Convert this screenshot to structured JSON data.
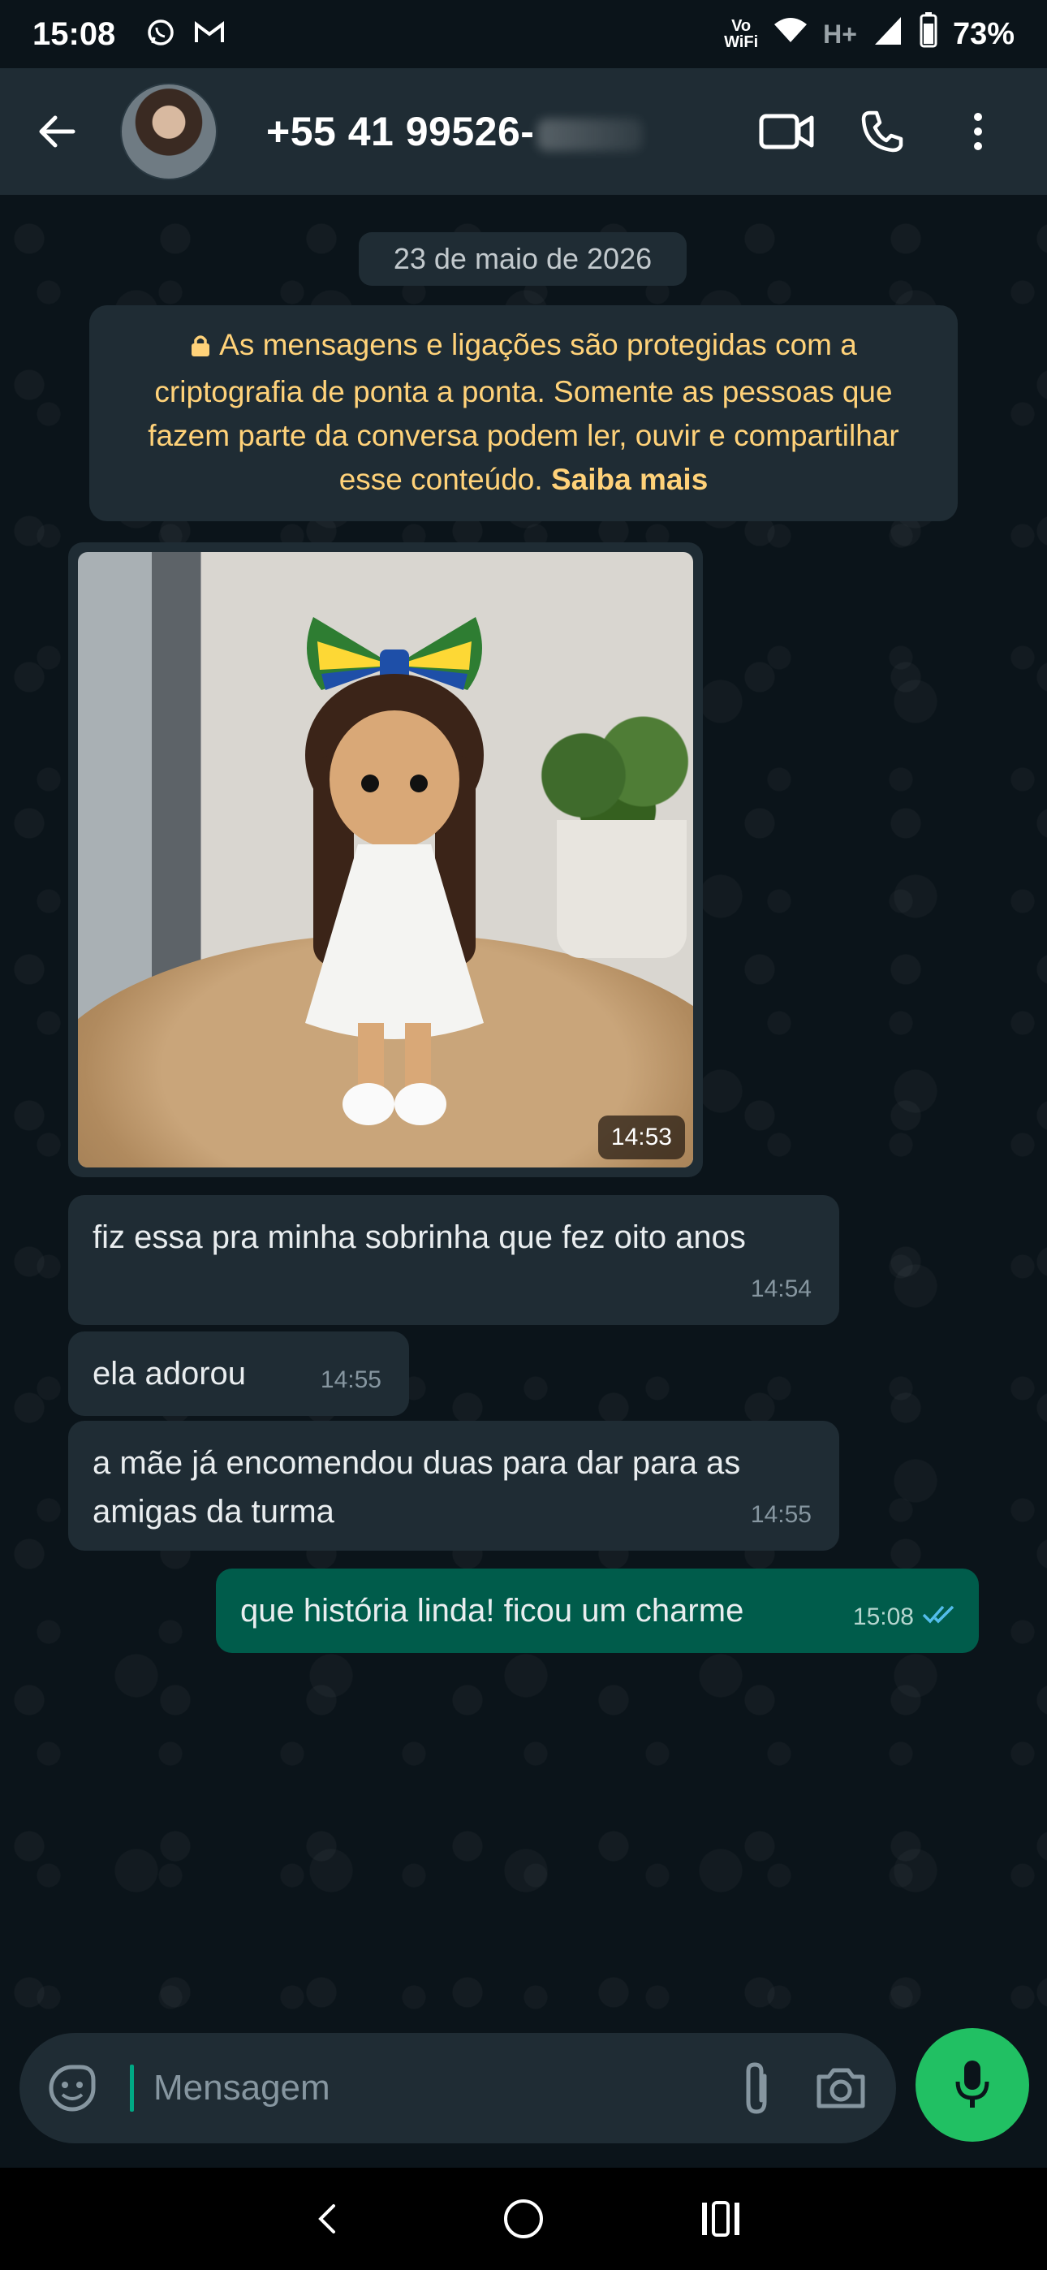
{
  "status_bar": {
    "time": "15:08",
    "left_icons": [
      "whatsapp-icon",
      "gmail-icon"
    ],
    "vowifi": "Vo\nWiFi",
    "network": "H+",
    "battery": "73%"
  },
  "header": {
    "contact_name": "+55 41 99526-",
    "icons": [
      "back-arrow-icon",
      "avatar",
      "video-call-icon",
      "phone-call-icon",
      "more-vert-icon"
    ]
  },
  "chat": {
    "date_chip": "23 de maio de 2026",
    "e2e_notice": {
      "text": "As mensagens e ligações são protegidas com a criptografia de ponta a ponta. Somente as pessoas que fazem parte da conversa podem ler, ouvir e compartilhar esse conteúdo.",
      "link": "Saiba mais",
      "color": "#ffd279"
    },
    "image_message": {
      "time": "14:53"
    },
    "messages": [
      {
        "direction": "in",
        "text": "fiz essa pra minha sobrinha que fez oito anos",
        "time": "14:54"
      },
      {
        "direction": "in",
        "text": "ela adorou",
        "time": "14:55"
      },
      {
        "direction": "in",
        "text": "a mãe já encomendou duas para dar para as amigas da turma",
        "time": "14:55"
      },
      {
        "direction": "out",
        "text": "que história linda! ficou um charme",
        "time": "15:08",
        "status": "read"
      }
    ]
  },
  "composer": {
    "placeholder": "Mensagem",
    "value": "",
    "icons": [
      "emoji-sticker-icon",
      "attach-icon",
      "camera-icon",
      "mic-icon"
    ]
  },
  "nav_bar": {
    "buttons": [
      "back",
      "home",
      "recents"
    ]
  },
  "colors": {
    "background": "#0b141a",
    "header": "#1f2c34",
    "incoming": "#1f2c34",
    "outgoing": "#005c4b",
    "accent": "#21c063",
    "read_ticks": "#53bdeb"
  }
}
